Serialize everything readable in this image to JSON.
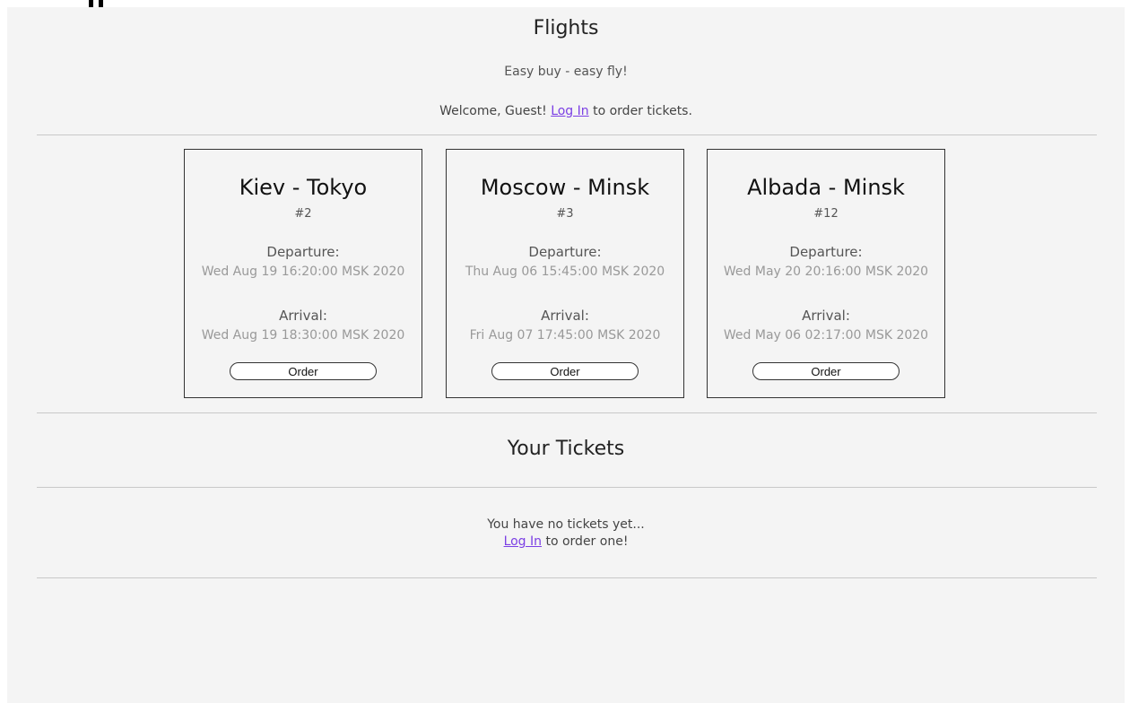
{
  "header": {
    "title": "Flights",
    "tagline": "Easy buy - easy fly!",
    "welcome_prefix": "Welcome, Guest! ",
    "login_link": "Log In",
    "welcome_suffix": " to order tickets."
  },
  "flights": [
    {
      "route": "Kiev - Tokyo",
      "number": "#2",
      "departure_label": "Departure:",
      "departure": "Wed Aug 19 16:20:00 MSK 2020",
      "arrival_label": "Arrival:",
      "arrival": "Wed Aug 19 18:30:00 MSK 2020",
      "order_label": "Order"
    },
    {
      "route": "Moscow - Minsk",
      "number": "#3",
      "departure_label": "Departure:",
      "departure": "Thu Aug 06 15:45:00 MSK 2020",
      "arrival_label": "Arrival:",
      "arrival": "Fri Aug 07 17:45:00 MSK 2020",
      "order_label": "Order"
    },
    {
      "route": "Albada - Minsk",
      "number": "#12",
      "departure_label": "Departure:",
      "departure": "Wed May 20 20:16:00 MSK 2020",
      "arrival_label": "Arrival:",
      "arrival": "Wed May 06 02:17:00 MSK 2020",
      "order_label": "Order"
    }
  ],
  "tickets": {
    "title": "Your Tickets",
    "empty_text": "You have no tickets yet...",
    "login_link": "Log In",
    "login_suffix": " to order one!"
  },
  "colors": {
    "page_bg": "#f4f4f4",
    "link": "#7b3fe4",
    "divider": "#c8c8c8",
    "card_border": "#333333"
  }
}
